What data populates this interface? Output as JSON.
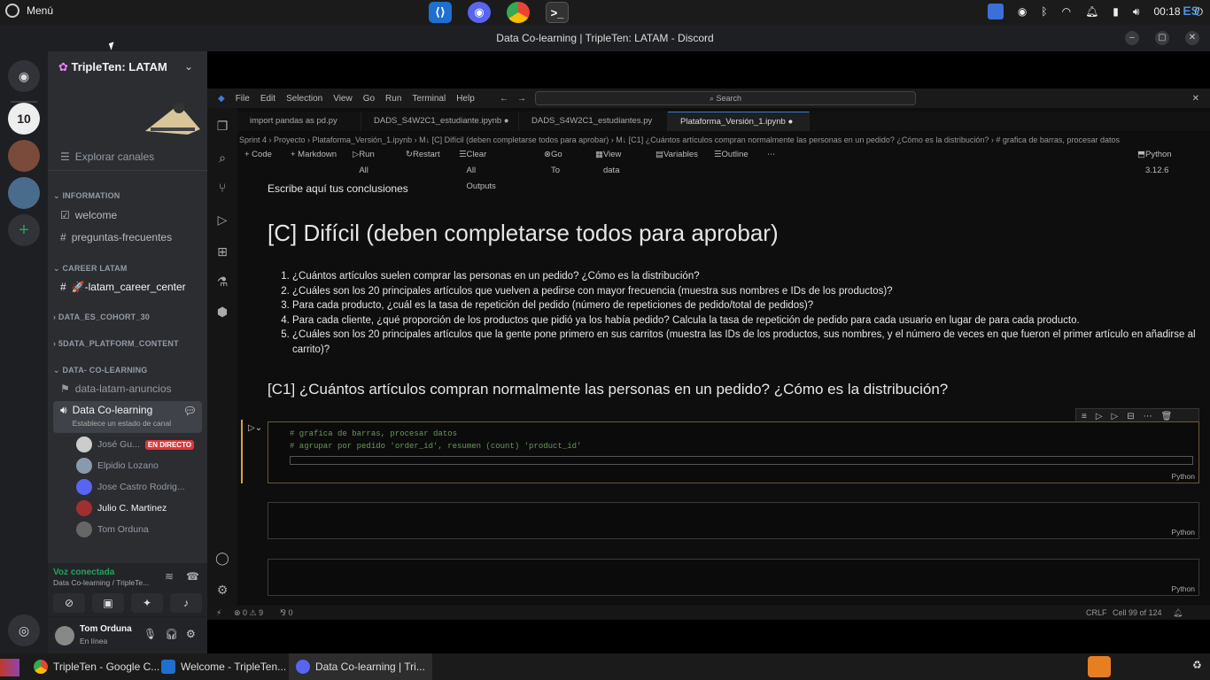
{
  "os": {
    "menu_label": "Menú",
    "lang": "ES",
    "clock": "00:18"
  },
  "window": {
    "title": "Data Co-learning | TripleTen: LATAM - Discord"
  },
  "discord": {
    "server_name": "TripleTen: LATAM",
    "explore": "Explorar canales",
    "categories": {
      "information": "INFORMATION",
      "career": "CAREER LATAM",
      "cohort": "DATA_ES_COHORT_30",
      "platform": "5DATA_PLATFORM_CONTENT",
      "colearning": "DATA- CO-LEARNING"
    },
    "channels": {
      "welcome": "welcome",
      "faq": "preguntas-frecuentes",
      "career_center": "🚀-latam_career_center",
      "anuncios": "data-latam-anuncios",
      "colearning": "Data Co-learning",
      "colearning_status": "Establece un estado de canal"
    },
    "voice_users": [
      {
        "name": "José Gu...",
        "live": "EN DIRECTO"
      },
      {
        "name": "Elpidio Lozano"
      },
      {
        "name": "Jose Castro Rodrig..."
      },
      {
        "name": "Julio C. Martinez"
      },
      {
        "name": "Tom Orduna"
      }
    ],
    "voice": {
      "status": "Voz conectada",
      "location": "Data Co-learning / TripleTe..."
    },
    "me": {
      "name": "Tom Orduna",
      "status": "En línea"
    }
  },
  "vscode": {
    "menu": [
      "File",
      "Edit",
      "Selection",
      "View",
      "Go",
      "Run",
      "Terminal",
      "Help"
    ],
    "search": "Search",
    "tabs": [
      "import pandas as pd.py",
      "DADS_S4W2C1_estudiante.ipynb",
      "DADS_S4W2C1_estudiantes.py",
      "Plataforma_Versión_1.ipynb"
    ],
    "breadcrumb": "Sprint 4 › Proyecto › Plataforma_Versión_1.ipynb › M↓ [C] Difícil (deben completarse todos para aprobar) › M↓ [C1] ¿Cuántos artículos compran normalmente las personas en un pedido? ¿Cómo es la distribución? › # grafica de barras, procesar datos",
    "toolbar": {
      "code": "+ Code",
      "markdown": "+ Markdown",
      "run_all": "Run All",
      "restart": "Restart",
      "clear": "Clear All Outputs",
      "goto": "Go To",
      "view_data": "View data",
      "variables": "Variables",
      "outline": "Outline",
      "kernel": "Python 3.12.6"
    },
    "notebook": {
      "conclusions": "Escribe aquí tus conclusiones",
      "heading": "[C] Difícil (deben completarse todos para aprobar)",
      "items": [
        "¿Cuántos artículos suelen comprar las personas en un pedido? ¿Cómo es la distribución?",
        "¿Cuáles son los 20 principales artículos que vuelven a pedirse con mayor frecuencia (muestra sus nombres e IDs de los productos)?",
        "Para cada producto, ¿cuál es la tasa de repetición del pedido (número de repeticiones de pedido/total de pedidos)?",
        "Para cada cliente, ¿qué proporción de los productos que pidió ya los había pedido? Calcula la tasa de repetición de pedido para cada usuario en lugar de para cada producto.",
        "¿Cuáles son los 20 principales artículos que la gente pone primero en sus carritos (muestra las IDs de los productos, sus nombres, y el número de veces en que fueron el primer artículo en añadirse al carrito)?"
      ],
      "subheading": "[C1] ¿Cuántos artículos compran normalmente las personas en un pedido? ¿Cómo es la distribución?",
      "code_line1": "# grafica de barras, procesar datos",
      "code_line2": "# agrupar por pedido 'order_id', resumen (count) 'product_id'",
      "cell_lang": "Python"
    },
    "status": {
      "errors": "⊗ 0 ⚠ 9",
      "ports": "⅋ 0",
      "eol": "CRLF",
      "cell": "Cell 99 of 124"
    }
  },
  "taskbar": {
    "items": [
      "TripleTen - Google C...",
      "Welcome - TripleTen...",
      "Data Co-learning | Tri..."
    ]
  }
}
